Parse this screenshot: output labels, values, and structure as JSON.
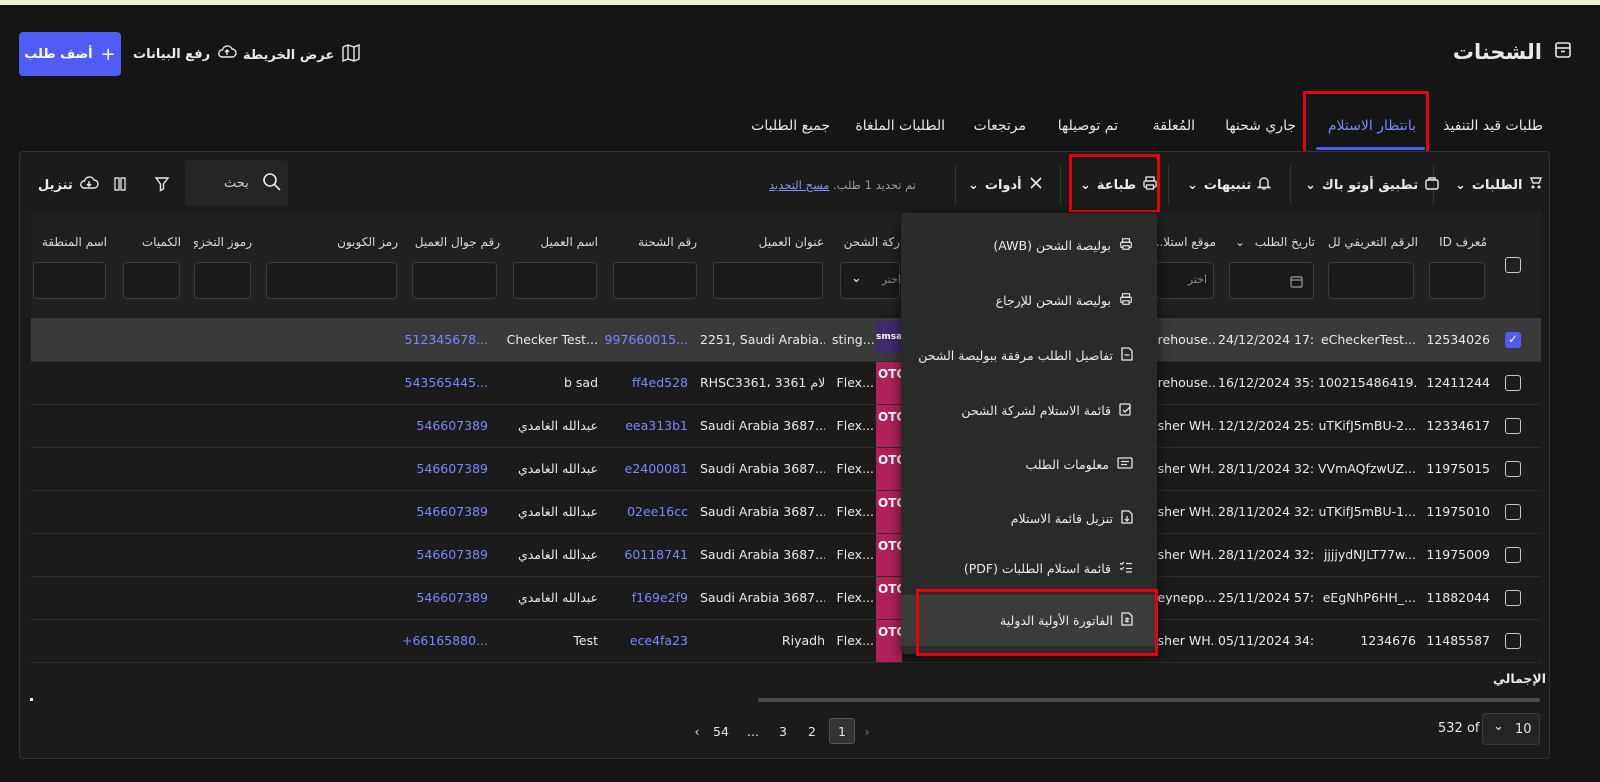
{
  "header": {
    "page_title": "الشحنات",
    "add_order": "أضف طلب",
    "upload_data": "رفع البيانات",
    "show_map": "عرض الخريطة"
  },
  "tabs": [
    "طلبات قيد التنفيذ",
    "بانتظار الاستلام",
    "جاري شحنها",
    "المُعلقة",
    "تم توصيلها",
    "مرتجعات",
    "الطلبات الملغاة",
    "جميع الطلبات"
  ],
  "toolbar": {
    "orders": "الطلبات",
    "autopack": "تطبيق أوتو باك",
    "alerts": "تنبيهات",
    "print": "طباعة",
    "tools": "أدوات",
    "selected_info": "تم تحديد 1 طلب.",
    "clear_selection": "مسح التحديد",
    "search_placeholder": "بحث",
    "download": "تنزيل"
  },
  "columns": [
    "مُعرف ID",
    "الرقم التعريفي لل...",
    "تاريخ الطلب",
    "موقع استلا...",
    "ركة الشحن",
    "عنوان العميل",
    "رقم الشحنة",
    "اسم العميل",
    "رقم جوال العميل",
    "رمز الكوبون",
    "رموز التخزي...",
    "الكميات",
    "اسم المنطقة"
  ],
  "filters": {
    "select_placeholder": "اختر"
  },
  "print_menu": [
    "بوليصة الشحن (AWB)",
    "بوليصة الشحن للإرجاع",
    "تفاصيل الطلب مرفقة ببوليصة الشحن",
    "قائمة الاستلام لشركة الشحن",
    "معلومات الطلب",
    "تنزيل قائمة الاستلام",
    "قائمة استلام الطلبات (PDF)",
    "الفاتورة الأولية الدولية"
  ],
  "rows": [
    {
      "selected": true,
      "id": "12534026",
      "ref": "eCheckerTest...",
      "date": "24/12/2024 17:...",
      "loc": "arehouse...",
      "carrier": "sting...",
      "carrier_logo": "smsa",
      "address": "2251, Saudi Arabia...",
      "shipment": "997660015...",
      "name": "Checker Test...",
      "phone": "512345678..."
    },
    {
      "selected": false,
      "id": "12411244",
      "ref": "100215486419...",
      "date": "16/12/2024 35:...",
      "loc": "arehouse...",
      "carrier": "Flex...",
      "carrier_logo": "OTO",
      "address": "RHSC3361، 3361 الام...",
      "shipment": "ff4ed528",
      "name": "b sad",
      "phone": "543565445..."
    },
    {
      "selected": false,
      "id": "12334617",
      "ref": "uTKifJ5mBU-2...",
      "date": "12/12/2024 25:...",
      "loc": "asher WH...",
      "carrier": "Flex...",
      "carrier_logo": "OTO",
      "address": "Saudi Arabia 3687...",
      "shipment": "eea313b1",
      "name": "عبدالله الغامدي",
      "phone": "546607389"
    },
    {
      "selected": false,
      "id": "11975015",
      "ref": "VVmAQfzwUZ...",
      "date": "28/11/2024 32:...",
      "loc": "asher WH...",
      "carrier": "Flex...",
      "carrier_logo": "OTO",
      "address": "Saudi Arabia 3687...",
      "shipment": "e2400081",
      "name": "عبدالله الغامدي",
      "phone": "546607389"
    },
    {
      "selected": false,
      "id": "11975010",
      "ref": "uTKifJ5mBU-1...",
      "date": "28/11/2024 32:...",
      "loc": "asher WH...",
      "carrier": "Flex...",
      "carrier_logo": "OTO",
      "address": "Saudi Arabia 3687...",
      "shipment": "02ee16cc",
      "name": "عبدالله الغامدي",
      "phone": "546607389"
    },
    {
      "selected": false,
      "id": "11975009",
      "ref": "jjjjydNJLT77w...",
      "date": "28/11/2024 32:...",
      "loc": "asher WH...",
      "carrier": "Flex...",
      "carrier_logo": "OTO",
      "address": "Saudi Arabia 3687...",
      "shipment": "60118741",
      "name": "عبدالله الغامدي",
      "phone": "546607389"
    },
    {
      "selected": false,
      "id": "11882044",
      "ref": "eEgNhP6HH_...",
      "date": "25/11/2024 57:...",
      "loc": "zeynepp...",
      "carrier": "Flex...",
      "carrier_logo": "OTO",
      "address": "Saudi Arabia 3687...",
      "shipment": "f169e2f9",
      "name": "عبدالله الغامدي",
      "phone": "546607389"
    },
    {
      "selected": false,
      "id": "11485587",
      "ref": "1234676",
      "date": "05/11/2024 34:...",
      "loc": "asher WH...",
      "carrier": "Flex...",
      "carrier_logo": "OTO",
      "address": "Riyadh",
      "shipment": "ece4fa23",
      "name": "Test",
      "phone": "+66165880..."
    }
  ],
  "footer": {
    "total_label": "الإجمالي",
    "page_size": "10",
    "total_count": "532 of",
    "pages": [
      "1",
      "2",
      "3",
      "...",
      "54"
    ]
  },
  "colors": {
    "accent": "#4f5cf5",
    "link": "#7c86ff",
    "highlight": "#e4000f",
    "otologo": "#b0215a"
  }
}
